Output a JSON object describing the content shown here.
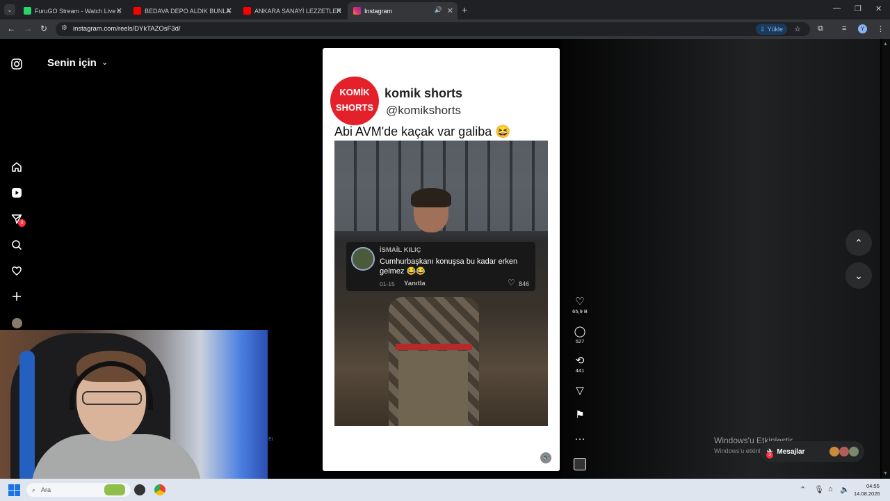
{
  "browser": {
    "tabs": [
      {
        "label": "FuruGO Stream - Watch Live on",
        "favicon_color": "#27d56b",
        "active": false
      },
      {
        "label": "BEDAVA DEPO ALDIK BUNLAR",
        "favicon_color": "#ff0000",
        "active": false
      },
      {
        "label": "ANKARA SANAYİ LEZZETLERİNİ",
        "favicon_color": "#ff0000",
        "active": false
      },
      {
        "label": "Instagram",
        "favicon_color": "#e1306c",
        "active": true
      }
    ],
    "url": "instagram.com/reels/DYkTAZOsF3d/",
    "install_label": "Yükle",
    "profile_initial": "Y"
  },
  "sidebar": {
    "feed_title": "Senin için",
    "notification_count": "3"
  },
  "reel": {
    "logo_line1": "KOMİK",
    "logo_line2": "SHORTS",
    "account_name": "komik shorts",
    "account_handle": "@komikshorts",
    "caption": "Abi AVM'de kaçak var galiba 😆",
    "comment": {
      "user": "İSMAİL KILIÇ",
      "text": "Cumhurbaşkanı konuşsa bu kadar erken gelmez 😂😂",
      "date": "01-15",
      "reply_label": "Yanıtla",
      "likes": "846"
    }
  },
  "actions": {
    "likes": "65,9 B",
    "comments": "527",
    "reposts": "441"
  },
  "overlay": {
    "activation_title": "Windows'u Etkinleştir",
    "activation_sub": "Windows'u etkinleştirmek için Ayarlar'a gidin.",
    "messages_label": "Mesajlar",
    "messages_badge": "3",
    "left_link": "Et"
  },
  "taskbar": {
    "search_placeholder": "Ara",
    "time": "04:55",
    "date": "14.08.2026"
  }
}
